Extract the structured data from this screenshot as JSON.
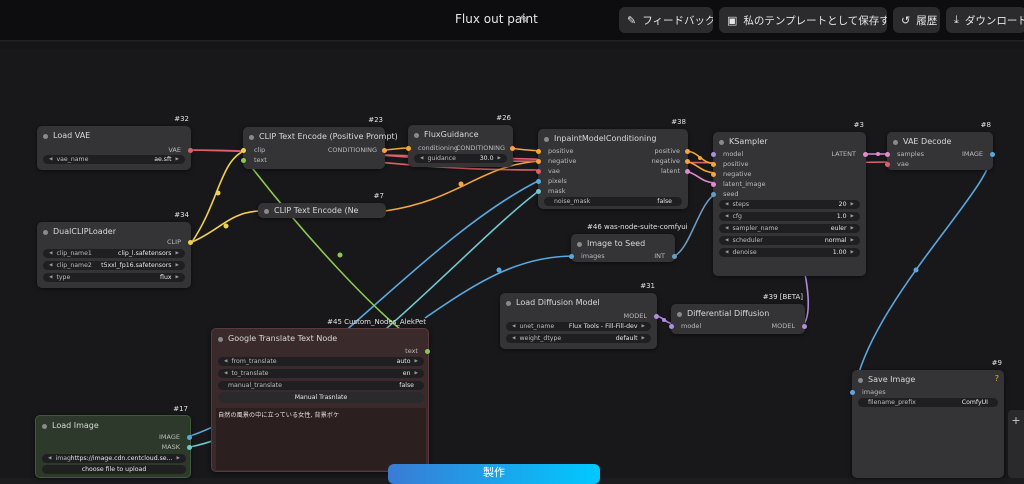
{
  "topbar": {
    "title": "Flux out paint",
    "buttons": [
      {
        "label": "フィードバック",
        "icon": "feedback-icon"
      },
      {
        "label": "私のテンプレートとして保存する",
        "icon": "save-icon"
      },
      {
        "label": "履歴",
        "icon": "history-icon"
      },
      {
        "label": "ダウンロード",
        "icon": "download-icon"
      }
    ]
  },
  "nodes": {
    "load_vae": {
      "id": "#32",
      "title": "Load VAE",
      "out": "VAE",
      "vae_name_label": "vae_name",
      "vae_name_value": "ae.sft"
    },
    "dual_clip": {
      "id": "#34",
      "title": "DualCLIPLoader",
      "out": "CLIP",
      "w1_label": "clip_name1",
      "w1_value": "clip_l.safetensors",
      "w2_label": "clip_name2",
      "w2_value": "t5xxl_fp16.safetensors",
      "w3_label": "type",
      "w3_value": "flux"
    },
    "clip_pos": {
      "id": "#23",
      "title": "CLIP Text Encode (Positive Prompt)",
      "in1": "clip",
      "in2": "text",
      "out": "CONDITIONING"
    },
    "clip_neg": {
      "id": "#7",
      "title": "CLIP Text Encode (Ne"
    },
    "flux_guidance": {
      "id": "#26",
      "title": "FluxGuidance",
      "in1": "conditioning",
      "out": "CONDITIONING",
      "w_label": "guidance",
      "w_value": "30.0"
    },
    "inpaint": {
      "id": "#38",
      "title": "InpaintModelConditioning",
      "in1": "positive",
      "in2": "negative",
      "in3": "vae",
      "in4": "pixels",
      "in5": "mask",
      "out1": "positive",
      "out2": "negative",
      "out3": "latent",
      "w_label": "noise_mask",
      "w_value": "false"
    },
    "ksampler": {
      "id": "#3",
      "title": "KSampler",
      "in1": "model",
      "in2": "positive",
      "in3": "negative",
      "in4": "latent_image",
      "in5": "seed",
      "out": "LATENT",
      "w1_label": "steps",
      "w1_value": "20",
      "w2_label": "cfg",
      "w2_value": "1.0",
      "w3_label": "sampler_name",
      "w3_value": "euler",
      "w4_label": "scheduler",
      "w4_value": "normal",
      "w5_label": "denoise",
      "w5_value": "1.00"
    },
    "vae_decode": {
      "id": "#8",
      "title": "VAE Decode",
      "in1": "samples",
      "in2": "vae",
      "out": "IMAGE"
    },
    "image_to_seed": {
      "id": "#46 was-node-suite-comfyui",
      "title": "Image to Seed",
      "in1": "images",
      "out": "INT"
    },
    "load_diffusion": {
      "id": "#31",
      "title": "Load Diffusion Model",
      "out": "MODEL",
      "w1_label": "unet_name",
      "w1_value": "Flux Tools - Fill-Fill-dev",
      "w2_label": "weight_dtype",
      "w2_value": "default"
    },
    "diff_diffusion": {
      "id": "#39 [BETA]",
      "title": "Differential Diffusion",
      "in1": "model",
      "out": "MODEL"
    },
    "translate": {
      "id": "#45 Custom_Nodes_AlekPet",
      "title": "Google Translate Text Node",
      "out": "text",
      "w1_label": "from_translate",
      "w1_value": "auto",
      "w2_label": "to_translate",
      "w2_value": "en",
      "w3_label": "manual_translate",
      "w3_value": "false",
      "button": "Manual Trasnlate",
      "text": "自然の風景の中に立っている女性, 背景ボケ"
    },
    "save_image": {
      "id": "#9",
      "title": "Save Image",
      "in1": "images",
      "help": "?",
      "w_label": "filename_prefix",
      "w_value": "ComfyUI"
    },
    "load_image": {
      "id": "#17",
      "title": "Load Image",
      "out1": "IMAGE",
      "out2": "MASK",
      "w_label": "image",
      "w_value": "https://image.cdn.centcloud.se...",
      "button": "choose file to upload"
    }
  },
  "generate_button": "製作",
  "zoom_controls": {
    "plus": "+"
  }
}
